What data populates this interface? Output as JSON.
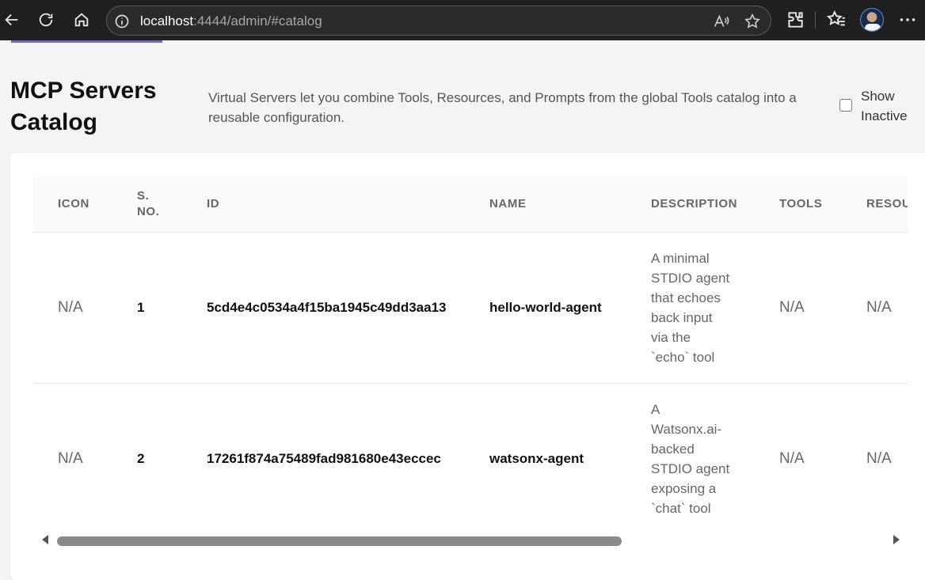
{
  "browser": {
    "url_host": "localhost",
    "url_rest": ":4444/admin/#catalog"
  },
  "page": {
    "title": "MCP Servers Catalog",
    "description": "Virtual Servers let you combine Tools, Resources, and Prompts from the global Tools catalog into a reusable configuration.",
    "show_inactive_label": "Show Inactive",
    "show_inactive_checked": false
  },
  "table": {
    "headers": [
      "ICON",
      "S. NO.",
      "ID",
      "NAME",
      "DESCRIPTION",
      "TOOLS",
      "RESOURCES"
    ],
    "rows": [
      {
        "icon": "N/A",
        "sno": "1",
        "id": "5cd4e4c0534a4f15ba1945c49dd3aa13",
        "name": "hello-world-agent",
        "description": "A minimal STDIO agent that echoes back input via the `echo` tool",
        "tools": "N/A",
        "resources": "N/A"
      },
      {
        "icon": "N/A",
        "sno": "2",
        "id": "17261f874a75489fad981680e43eccec",
        "name": "watsonx-agent",
        "description": "A Watsonx.ai-backed STDIO agent exposing a `chat` tool",
        "tools": "N/A",
        "resources": "N/A"
      }
    ]
  },
  "scrollbar": {
    "position_fraction": 0.0,
    "visible_fraction": 0.68
  },
  "colors": {
    "accent": "#6366f1",
    "chrome_bg": "#202020"
  }
}
